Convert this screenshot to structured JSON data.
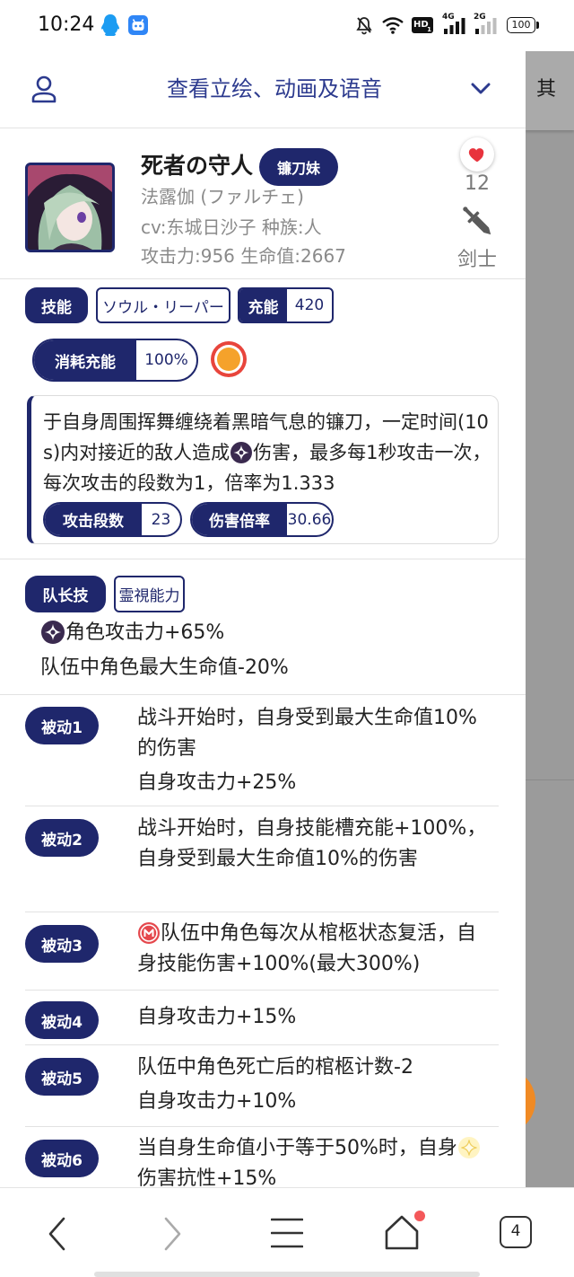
{
  "status_bar": {
    "time": "10:24",
    "hd_label": "HD",
    "hd_slot": "1",
    "sim1_network": "4G",
    "sim2_network": "2G",
    "battery": "100"
  },
  "header": {
    "title": "查看立绘、动画及语音",
    "side_tab": "其"
  },
  "character": {
    "name": "死者の守人",
    "nickname": "镰刀妹",
    "alias": "法露伽 (ファルチェ)",
    "cv_race": "cv:东城日沙子 种族:人",
    "stats": "攻击力:956 生命值:2667",
    "likes": "12",
    "class": "剑士"
  },
  "skill": {
    "label": "技能",
    "name": "ソウル・リーパー",
    "charge_label": "充能",
    "charge_value": "420",
    "consume_label": "消耗充能",
    "consume_value": "100%",
    "description_before_icon": "于自身周围挥舞缠绕着黑暗气息的镰刀，一定时间(10s)内对接近的敌人造成",
    "description_icon": "dark-element-icon",
    "description_after_icon": "伤害，最多每1秒攻击一次，每次攻击的段数为1，倍率为1.333",
    "hits_label": "攻击段数",
    "hits_value": "23",
    "multiplier_label": "伤害倍率",
    "multiplier_value": "30.66"
  },
  "leader_skill": {
    "label": "队长技",
    "name": "霊視能力",
    "effects": [
      {
        "icon": "dark-element-icon",
        "text": "角色攻击力+65%"
      },
      {
        "text": "队伍中角色最大生命值-20%"
      }
    ]
  },
  "passives": [
    {
      "label": "被动1",
      "paragraphs": [
        "战斗开始时，自身受到最大生命值10%的伤害",
        "自身攻击力+25%"
      ]
    },
    {
      "label": "被动2",
      "paragraphs": [
        "战斗开始时，自身技能槽充能+100%，自身受到最大生命值10%的伤害"
      ]
    },
    {
      "label": "被动3",
      "icon": "coffin-revive-icon",
      "paragraphs": [
        "队伍中角色每次从棺柩状态复活，自身技能伤害+100%(最大300%)"
      ]
    },
    {
      "label": "被动4",
      "paragraphs": [
        "自身攻击力+15%"
      ]
    },
    {
      "label": "被动5",
      "paragraphs": [
        "队伍中角色死亡后的棺柩计数-2",
        "自身攻击力+10%"
      ]
    },
    {
      "label": "被动6",
      "icon": "light-element-icon",
      "text_before_icon": "当自身生命值小于等于50%时，自身",
      "text_after_icon": "伤害抗性+15%"
    }
  ],
  "bottom_nav": {
    "tab_count": "4"
  },
  "colors": {
    "navy": "#1f276c",
    "header_text": "#2c3a8e",
    "heart": "#e8333d",
    "skill_icon_ring": "#e8453c",
    "skill_icon_core": "#f5a22b",
    "side_panel": "#9b9b9b",
    "fab": "#f08a24"
  }
}
